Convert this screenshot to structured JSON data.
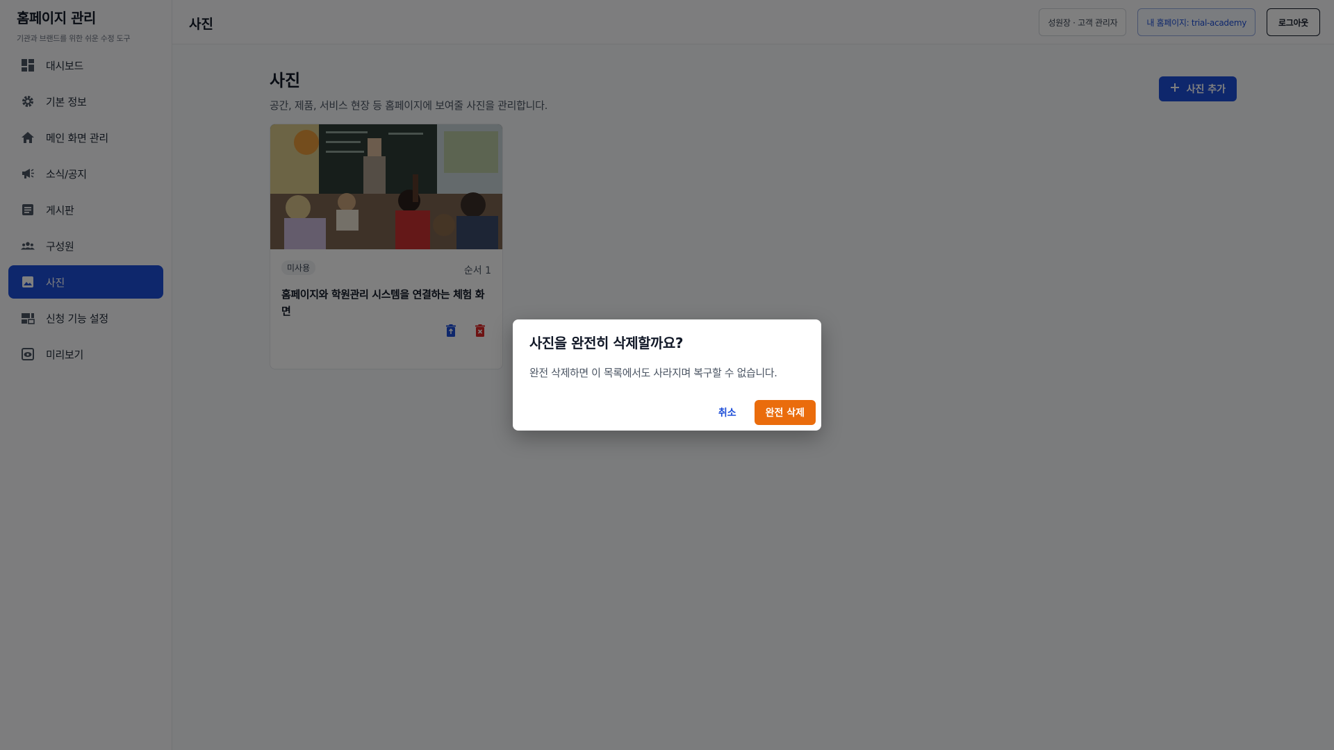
{
  "brand": {
    "title": "홈페이지 관리",
    "subtitle": "기관과 브랜드를 위한 쉬운 수정 도구"
  },
  "sidebar": {
    "items": [
      {
        "label": "대시보드",
        "icon": "dashboard-icon"
      },
      {
        "label": "기본 정보",
        "icon": "gear-icon"
      },
      {
        "label": "메인 화면 관리",
        "icon": "home-icon"
      },
      {
        "label": "소식/공지",
        "icon": "megaphone-icon"
      },
      {
        "label": "게시판",
        "icon": "document-icon"
      },
      {
        "label": "구성원",
        "icon": "group-icon"
      },
      {
        "label": "사진",
        "icon": "image-icon",
        "active": true
      },
      {
        "label": "신청 기능 설정",
        "icon": "form-icon"
      },
      {
        "label": "미리보기",
        "icon": "preview-icon"
      }
    ]
  },
  "header": {
    "title": "사진",
    "user_label": "성원장 · 고객 관리자",
    "site_label": "내 홈페이지: trial-academy",
    "logout_label": "로그아웃"
  },
  "main": {
    "title": "사진",
    "description": "공간, 제품, 서비스 현장 등 홈페이지에 보여줄 사진을 관리합니다.",
    "add_button_label": "사진 추가",
    "photos": [
      {
        "badge": "미사용",
        "order": "순서 1",
        "title": "홈페이지와 학원관리 시스템을 연결하는 체험 화면"
      }
    ]
  },
  "dialog": {
    "title": "사진을 완전히 삭제할까요?",
    "message": "완전 삭제하면 이 목록에서도 사라지며 복구할 수 없습니다.",
    "cancel_label": "취소",
    "confirm_label": "완전 삭제"
  },
  "colors": {
    "accent": "#1d4ed8",
    "danger": "#ea6c0c",
    "trash": "#dc2626"
  }
}
